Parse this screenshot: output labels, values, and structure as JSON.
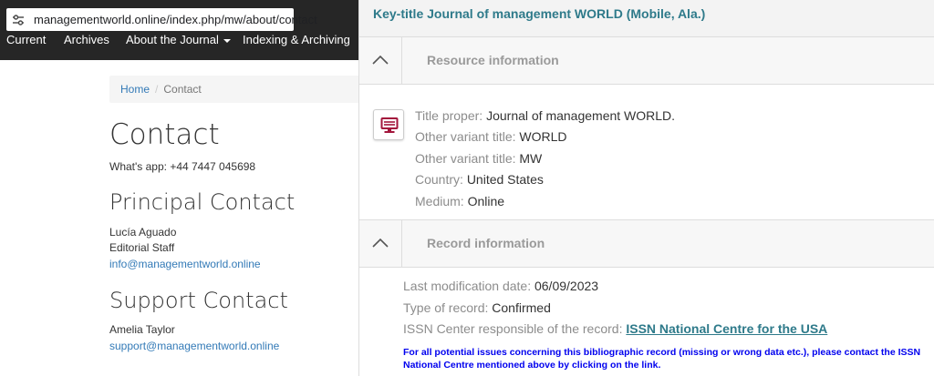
{
  "browser": {
    "url": "managementworld.online/index.php/mw/about/contact"
  },
  "nav": {
    "items": [
      {
        "label": "Current"
      },
      {
        "label": "Archives"
      },
      {
        "label": "About the Journal"
      },
      {
        "label": "Indexing & Archiving"
      }
    ]
  },
  "breadcrumb": {
    "home": "Home",
    "separator": "/",
    "current": "Contact"
  },
  "contact": {
    "title": "Contact",
    "whatsapp": "What's app: +44 7447 045698",
    "principal": {
      "heading": "Principal Contact",
      "name": "Lucía Aguado",
      "role": "Editorial Staff",
      "email": "info@managementworld.online"
    },
    "support": {
      "heading": "Support Contact",
      "name": "Amelia Taylor",
      "email": "support@managementworld.online"
    }
  },
  "record": {
    "key_title": "Key-title Journal of management WORLD (Mobile, Ala.)",
    "resource_section": "Resource information",
    "resource_fields": [
      {
        "label": "Title proper: ",
        "value": "Journal of management WORLD."
      },
      {
        "label": "Other variant title: ",
        "value": "WORLD"
      },
      {
        "label": "Other variant title: ",
        "value": "MW"
      },
      {
        "label": "Country: ",
        "value": "United States"
      },
      {
        "label": "Medium: ",
        "value": "Online"
      }
    ],
    "record_section": "Record information",
    "record_fields": [
      {
        "label": "Last modification date: ",
        "value": "06/09/2023"
      },
      {
        "label": "Type of record: ",
        "value": "Confirmed"
      }
    ],
    "center_label": "ISSN Center responsible of the record: ",
    "center_link": "ISSN National Centre for the USA",
    "notice": "For all potential issues concerning this bibliographic record (missing or wrong data etc.), please contact the ISSN National Centre mentioned above by clicking on the link."
  },
  "colors": {
    "topbar": "#262626",
    "link": "#337ab7",
    "record_title": "#2e7a8a",
    "notice": "#0000ee",
    "resource_icon": "#a3163c"
  },
  "icons": {
    "url_bar": "tune-icon",
    "resource": "computer-monitor-icon",
    "collapse": "chevron-up-icon"
  }
}
